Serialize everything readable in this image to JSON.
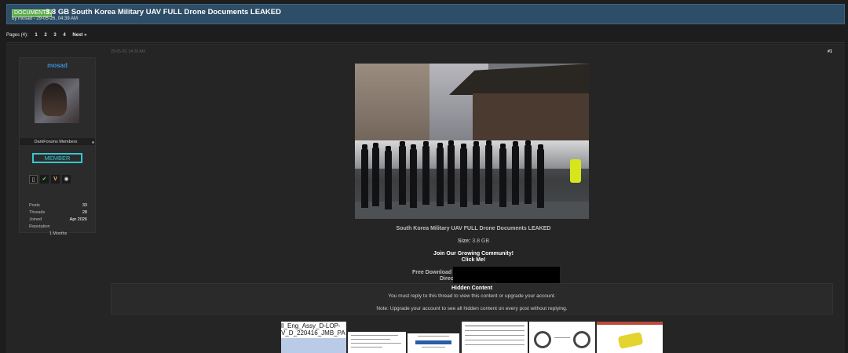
{
  "thread": {
    "prefix": "DOCUMENTS",
    "title": "3.8 GB South Korea Military UAV FULL Drone Documents LEAKED",
    "byline": "by mosad - 29-05-26, 04:39 AM"
  },
  "pagination": {
    "label": "Pages (4):",
    "pages": [
      "1",
      "2",
      "3",
      "4"
    ],
    "next": "Next »"
  },
  "post": {
    "date": "29-05-26, 04:39 AM",
    "number": "#1",
    "author": {
      "username": "mosad",
      "group": "DarkForums Members",
      "rank_badge": "MEMBER",
      "stats": [
        {
          "label": "Posts",
          "value": "33"
        },
        {
          "label": "Threads",
          "value": "28"
        },
        {
          "label": "Joined",
          "value": "Apr 2026"
        },
        {
          "label": "Reputation",
          "value": ""
        }
      ],
      "reputation_value": "1 Months"
    },
    "body": {
      "heading": "South Korea Military UAV FULL Drone Documents LEAKED",
      "size_label": "Size:",
      "size_value": "3.8 GB",
      "join_line1": "Join Our Growing Community!",
      "join_line2": "Click Me!",
      "download_line1": "Free Download",
      "download_line2": "Direc"
    },
    "hidden": {
      "title": "Hidden Content",
      "text": "You must reply to this thread to view this content or upgrade your account.",
      "note": "Note: Upgrade your account to see all hidden content on every post without replying."
    },
    "thumbnails": {
      "filename_line1": "ll_Eng_Assy_D-LOP-",
      "filename_line2": "V_D_220416_JMB_PA"
    }
  }
}
